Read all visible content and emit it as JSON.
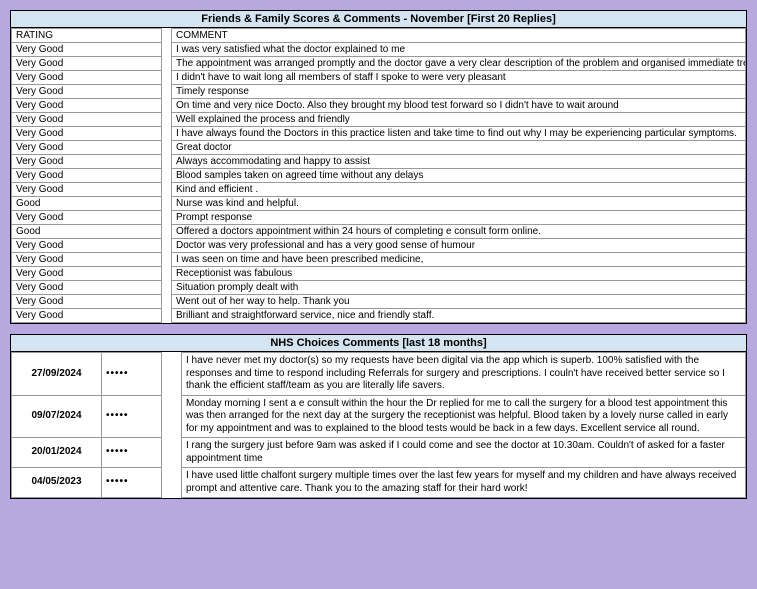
{
  "ff": {
    "title": "Friends & Family Scores & Comments - November [First 20 Replies]",
    "header_rating": "RATING",
    "header_comment": "COMMENT",
    "rows": [
      {
        "rating": "Very Good",
        "comment": "I was very satisfied what the doctor explained to me"
      },
      {
        "rating": "Very Good",
        "comment": "The appointment was arranged promptly and the doctor gave a very clear description of the problem and organised immediate tre"
      },
      {
        "rating": "Very Good",
        "comment": "I didn't have to wait long all members of staff I spoke to were very pleasant"
      },
      {
        "rating": "Very Good",
        "comment": "Timely response"
      },
      {
        "rating": "Very Good",
        "comment": "On time and very nice Docto. Also they brought my blood test forward so I didn't have to wait around"
      },
      {
        "rating": "Very Good",
        "comment": "Well explained the process and friendly"
      },
      {
        "rating": "Very Good",
        "comment": "I have always found the Doctors in this practice listen and take time to find out why I may be experiencing particular symptoms."
      },
      {
        "rating": "Very Good",
        "comment": "Great doctor"
      },
      {
        "rating": "Very Good",
        "comment": "Always accommodating and happy to assist"
      },
      {
        "rating": "Very Good",
        "comment": "Blood samples taken on agreed time without any delays"
      },
      {
        "rating": "Very Good",
        "comment": "Kind and efficient ."
      },
      {
        "rating": "Good",
        "comment": "Nurse was kind and helpful."
      },
      {
        "rating": "Very Good",
        "comment": "Prompt response"
      },
      {
        "rating": "Good",
        "comment": "Offered a doctors appointment within 24 hours of completing e consult form online."
      },
      {
        "rating": "Very Good",
        "comment": "Doctor was very professional and has a very good sense of humour"
      },
      {
        "rating": "Very Good",
        "comment": "I was seen on time and have been prescribed medicine,"
      },
      {
        "rating": "Very Good",
        "comment": "Receptionist was fabulous"
      },
      {
        "rating": "Very Good",
        "comment": "Situation promply dealt with"
      },
      {
        "rating": "Very Good",
        "comment": "Went out of her way to help. Thank you"
      },
      {
        "rating": "Very Good",
        "comment": "Brilliant and straightforward service, nice and friendly staff."
      }
    ]
  },
  "nhs": {
    "title": "NHS Choices Comments [last 18 months]",
    "rows": [
      {
        "date": "27/09/2024",
        "stars": "•••••",
        "comment": "I have never met my doctor(s) so my requests have been digital via the app which is superb. 100% satisfied with the responses and time to respond including Referrals for surgery and prescriptions. I couln't have received better service so I thank the efficient staff/team as you are literally life savers."
      },
      {
        "date": "09/07/2024",
        "stars": "•••••",
        "comment": "Monday morning I sent a e consult within the hour the Dr replied for me to call the surgery for a blood test appointment this was then arranged for the next day at the surgery the receptionist was helpful. Blood taken by a lovely nurse called in early for my appointment and was to explained to the blood tests would be back in a few days. Excellent service all round."
      },
      {
        "date": "20/01/2024",
        "stars": "•••••",
        "comment": "I rang the surgery just before 9am was asked if I could come and see the doctor at 10.30am. Couldn't of asked for a faster appointment time"
      },
      {
        "date": "04/05/2023",
        "stars": "•••••",
        "comment": "I have used little chalfont surgery multiple times over the last few years for myself and my children and have always received prompt and attentive care. Thank you to the amazing staff for their hard work!"
      }
    ]
  }
}
